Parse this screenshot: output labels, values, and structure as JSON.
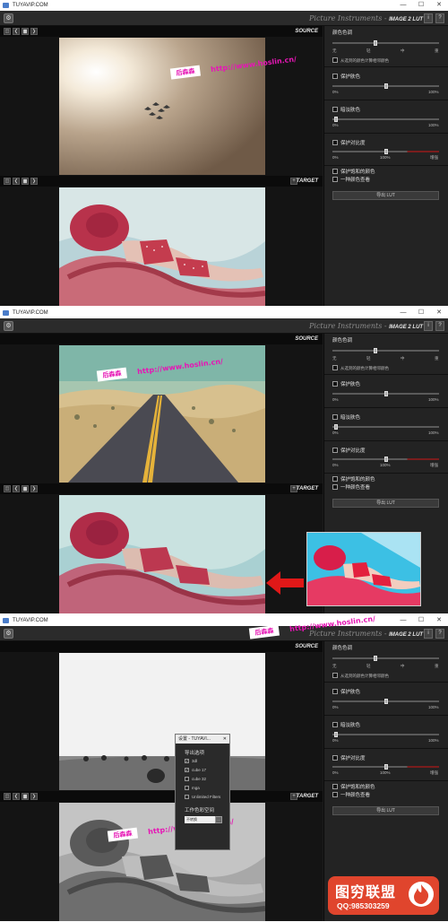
{
  "window": {
    "title": "TUYAVIP.COM",
    "minimize": "—",
    "maximize": "☐",
    "close": "✕"
  },
  "app": {
    "title_prefix": "Picture Instruments - ",
    "title_main": "IMAGE 2 LUT",
    "gear": "⚙",
    "info_btn": "i",
    "help_btn": "?"
  },
  "toolbar": {
    "buttons": [
      "◫",
      "❮",
      "▆",
      "❯"
    ],
    "source_label": "SOURCE",
    "target_label": "TARGET",
    "add_btn": "+"
  },
  "right_panel": {
    "color_tone": {
      "caption": "颜色色调",
      "ticks": [
        "无",
        "轻",
        "中",
        "重"
      ],
      "calc_from_selected": "从选到的颜色计算相邻颜色"
    },
    "protect_skin": {
      "caption": "保护肤色",
      "min": "0%",
      "max": "100%"
    },
    "dim_skin": {
      "caption": "暗淡肤色",
      "min": "0%",
      "max": "100%"
    },
    "protect_contrast": {
      "caption": "保护对比度",
      "min": "0%",
      "mid": "100%",
      "max": "增强"
    },
    "protect_saturation": "保护饱和的颜色",
    "single_color_view": "一种颜色查看",
    "export_btn": "导出 LUT"
  },
  "watermark": {
    "name": "后森森",
    "url": "http://www.hoslin.cn/"
  },
  "dialog": {
    "title": "设置 - TUYAVI...",
    "close": "✕",
    "export_section": "导出选项",
    "options": [
      {
        "label": "3dl",
        "checked": true
      },
      {
        "label": "cube 17",
        "checked": true
      },
      {
        "label": "cube 32",
        "checked": false
      },
      {
        "label": "mga",
        "checked": false
      },
      {
        "label": "Unlimited Filters",
        "checked": false
      }
    ],
    "colorspace_section": "工作色彩空间",
    "colorspace_value": "不转换",
    "colorspace_btn": "..."
  },
  "badge": {
    "name": "图穷联盟",
    "qq": "QQ:985303259"
  }
}
